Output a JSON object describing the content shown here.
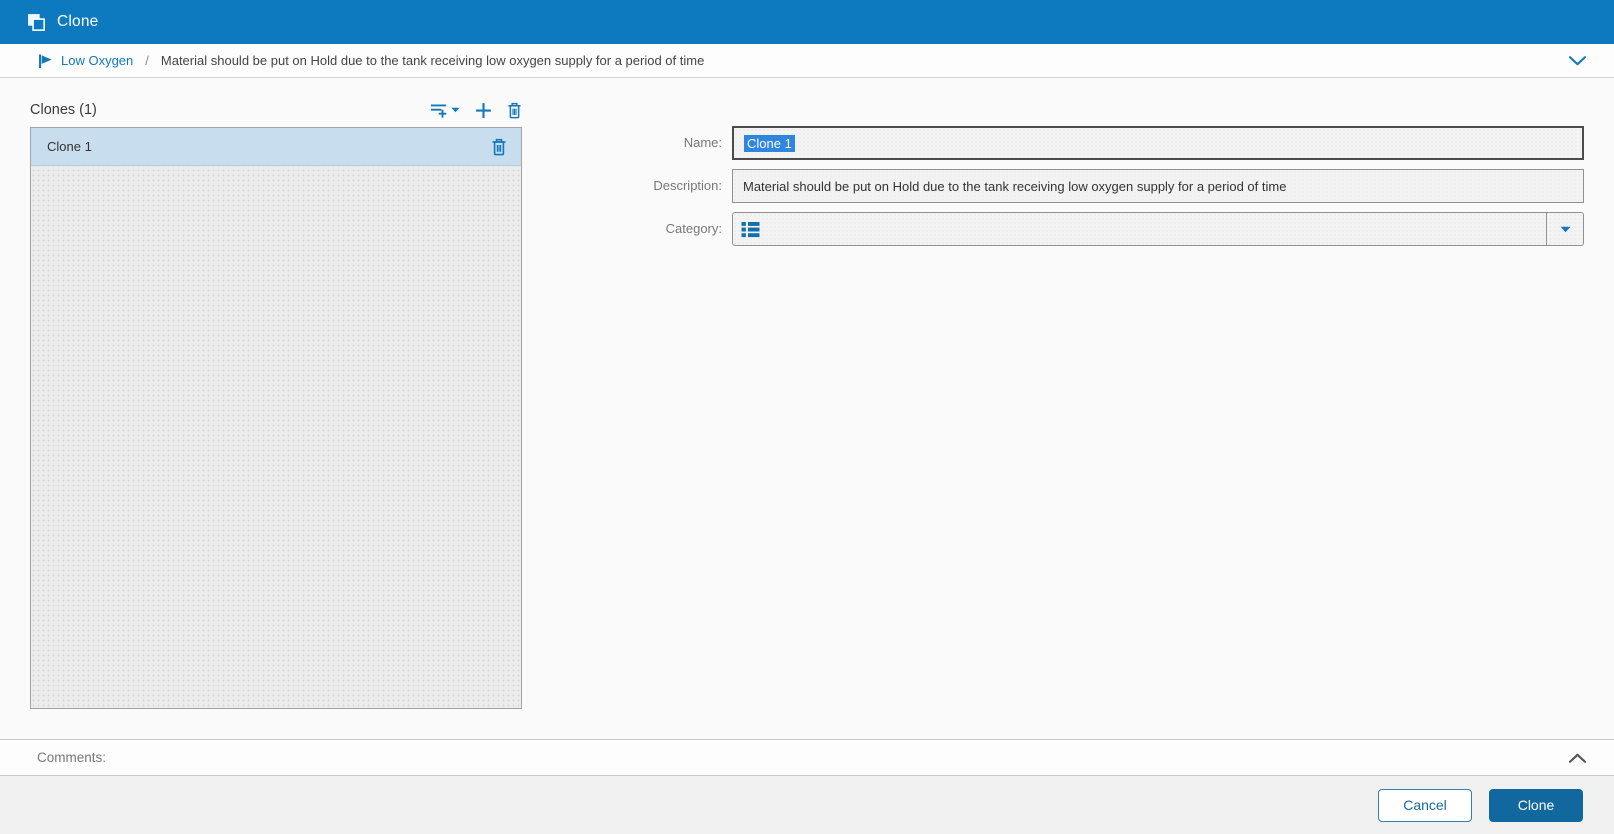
{
  "titlebar": {
    "title": "Clone"
  },
  "breadcrumb": {
    "link_label": "Low Oxygen",
    "separator": "/",
    "item_label": "Material should be put on Hold due to the tank receiving low oxygen supply for a period of time"
  },
  "clones_panel": {
    "title": "Clones (1)",
    "items": [
      {
        "name": "Clone 1",
        "selected": true
      }
    ]
  },
  "form": {
    "name_label": "Name:",
    "name_value": "Clone 1",
    "name_value_selected": true,
    "description_label": "Description:",
    "description_value": "Material should be put on Hold due to the tank receiving low oxygen supply for a period of time",
    "category_label": "Category:",
    "category_value": ""
  },
  "comments": {
    "label": "Comments:"
  },
  "footer": {
    "cancel_label": "Cancel",
    "submit_label": "Clone"
  },
  "icons": {
    "titlebar": "clone-copies-icon",
    "breadcrumb_left": "flag-icon",
    "breadcrumb_right": "chevron-down-icon",
    "toolbar": [
      "add-filter-icon",
      "caret-down-icon",
      "plus-icon",
      "trash-icon"
    ],
    "row_action": "trash-icon",
    "category_field": "category-list-icon",
    "category_dropdown": "caret-down-icon",
    "comments_right": "chevron-up-icon"
  },
  "colors": {
    "header_bg": "#0d7ac0",
    "accent_blue": "#1478ba",
    "selection_bg": "#2e86de",
    "selected_row_bg": "#c8ddee",
    "submit_bg": "#10689f"
  }
}
